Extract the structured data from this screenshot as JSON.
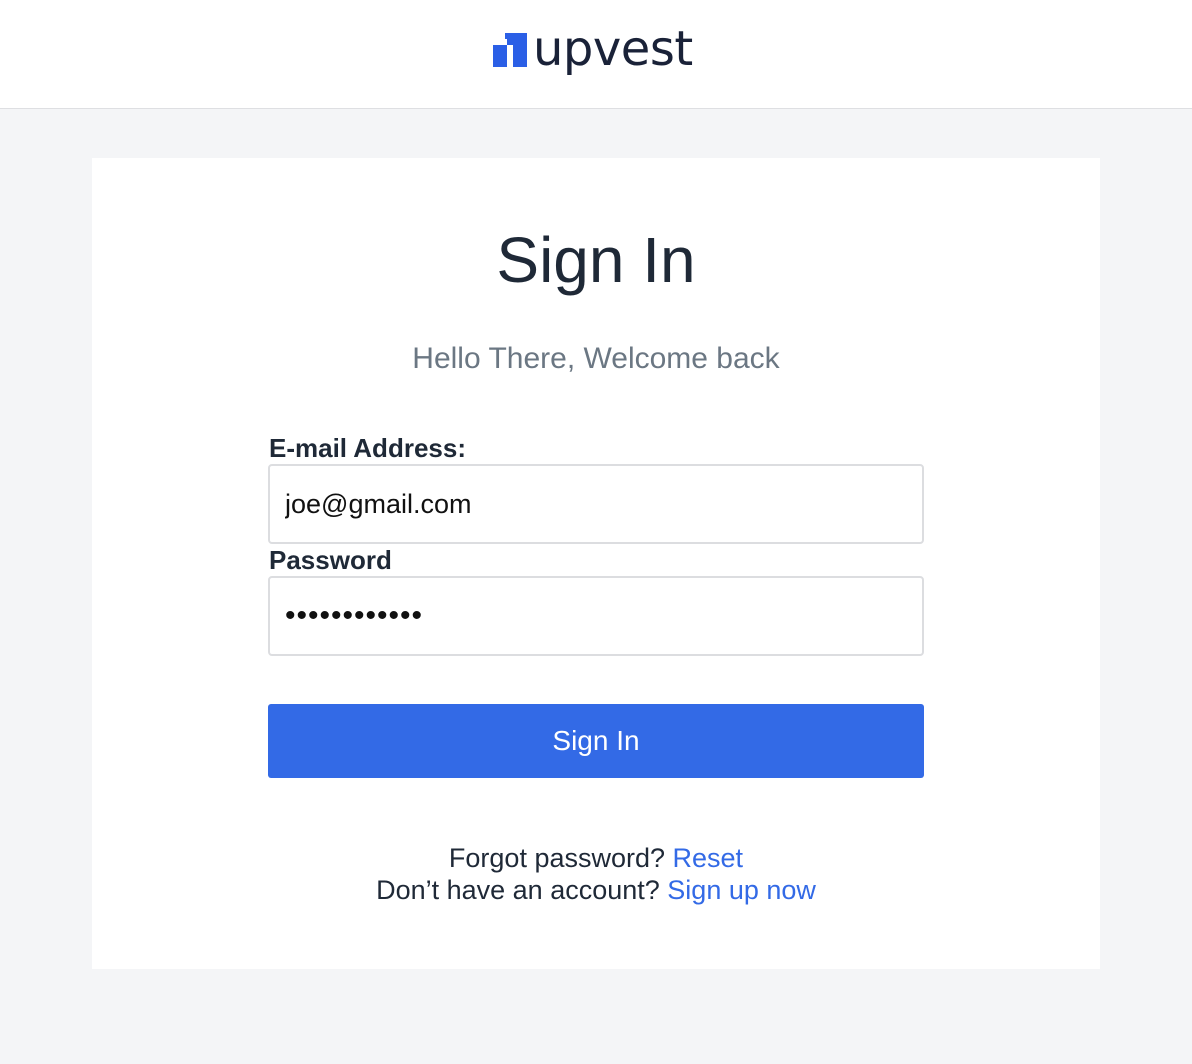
{
  "header": {
    "logo_text": "upvest",
    "logo_color": "#2b5fe6"
  },
  "form": {
    "title": "Sign In",
    "subtitle": "Hello There, Welcome back",
    "email_label": "E-mail Address:",
    "email_value": "joe@gmail.com",
    "password_label": "Password",
    "password_value": "••••••••••••",
    "submit_label": "Sign In"
  },
  "footer": {
    "forgot_text": "Forgot password?",
    "reset_link": "Reset",
    "signup_text": "Don’t have an account?",
    "signup_link": "Sign up now"
  },
  "colors": {
    "accent": "#336ae6",
    "background": "#f4f5f7",
    "text": "#1f2937",
    "muted": "#6b7783"
  }
}
